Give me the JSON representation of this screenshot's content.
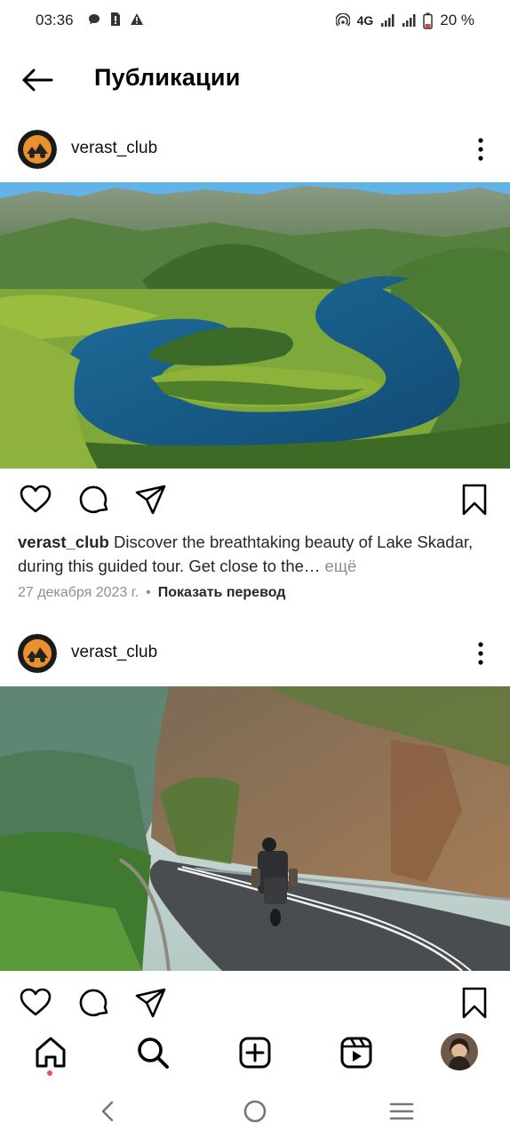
{
  "status_bar": {
    "time": "03:36",
    "network": "4G",
    "battery": "20 %"
  },
  "header": {
    "title": "Публикации"
  },
  "posts": [
    {
      "username": "verast_club",
      "caption_user": "verast_club",
      "caption_text": "Discover the breathtaking beauty of Lake Skadar, during this guided tour. Get close to the…",
      "caption_more": "ещё",
      "date": "27 декабря 2023 г.",
      "translate": "Показать перевод"
    },
    {
      "username": "verast_club"
    }
  ],
  "bottom_nav": {
    "items": [
      "home-icon",
      "search-icon",
      "create-icon",
      "reels-icon",
      "profile-avatar"
    ],
    "active": "home-icon",
    "notification_color": "#ed4956"
  }
}
